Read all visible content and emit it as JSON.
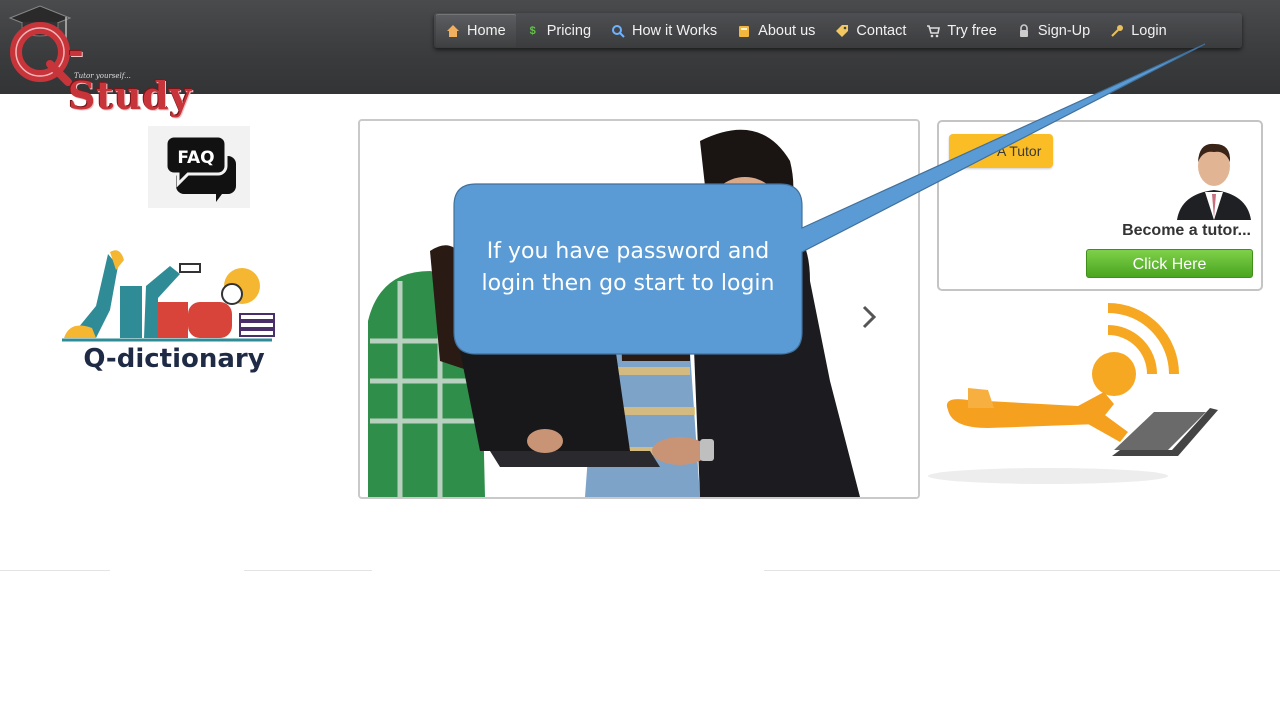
{
  "logo": {
    "text": "-Study",
    "tagline": "Tutor yourself..."
  },
  "nav": {
    "items": [
      {
        "label": "Home",
        "icon": "home-icon",
        "active": true
      },
      {
        "label": "Pricing",
        "icon": "dollar-icon"
      },
      {
        "label": "How it Works",
        "icon": "search-icon"
      },
      {
        "label": "About us",
        "icon": "book-icon"
      },
      {
        "label": "Contact",
        "icon": "tag-icon"
      },
      {
        "label": "Try free",
        "icon": "cart-icon"
      },
      {
        "label": "Sign-Up",
        "icon": "lock-icon"
      },
      {
        "label": "Login",
        "icon": "key-icon"
      }
    ]
  },
  "left": {
    "faq_label": "FAQ",
    "dictionary_label": "Q-dictionary"
  },
  "tutor_panel": {
    "badge": "A Tutor",
    "heading": "Become a tutor...",
    "button": "Click Here"
  },
  "callout": {
    "line1": "If you have password and",
    "line2": "login then go start to login"
  },
  "colors": {
    "header_bg": "#3b3c3e",
    "callout_fill": "#5b9bd5",
    "button_green": "#5cb82e",
    "badge_yellow": "#fbbd25",
    "logo_red": "#c7343a"
  }
}
